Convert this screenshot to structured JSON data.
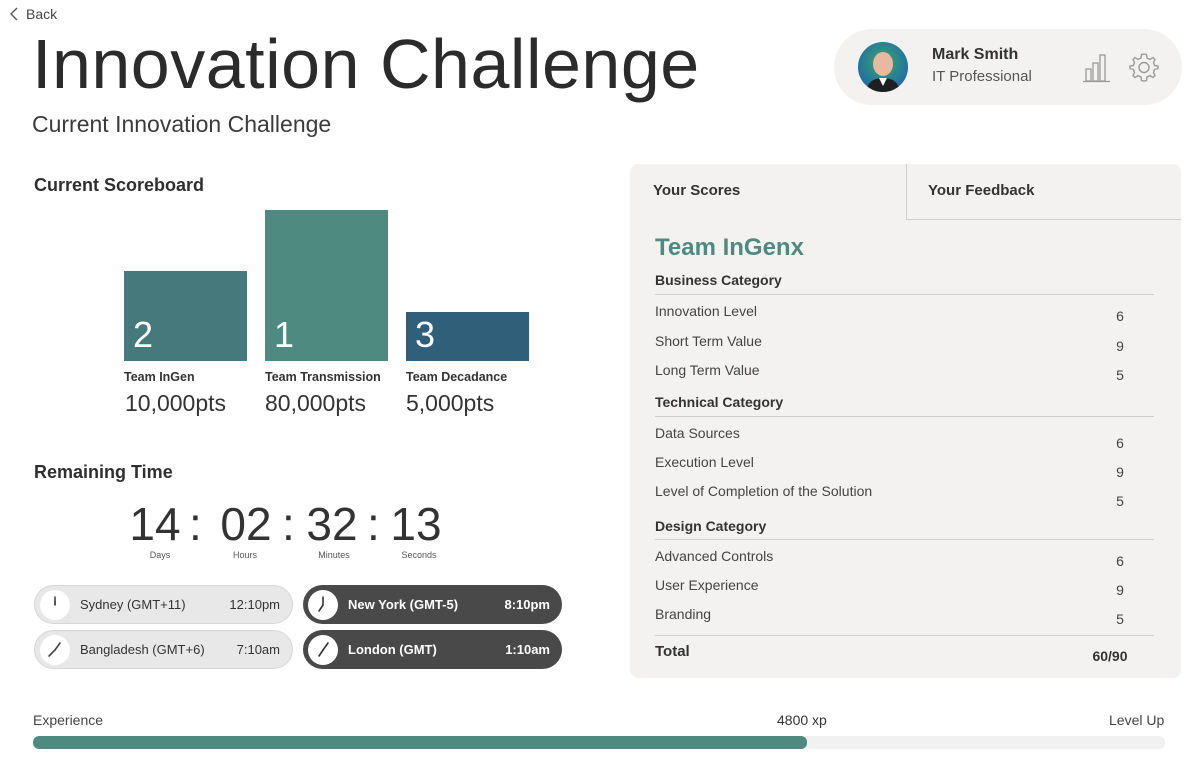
{
  "nav": {
    "back_label": "Back"
  },
  "header": {
    "title": "Innovation Challenge",
    "subtitle": "Current Innovation Challenge"
  },
  "profile": {
    "name": "Mark Smith",
    "role": "IT Professional",
    "icons": [
      "bar-chart-icon",
      "gear-icon"
    ]
  },
  "scoreboard": {
    "title": "Current Scoreboard",
    "teams": [
      {
        "rank": "2",
        "name": "Team InGen",
        "points": "10,000pts",
        "color": "#46797c"
      },
      {
        "rank": "1",
        "name": "Team Transmission",
        "points": "80,000pts",
        "color": "#4f8a80"
      },
      {
        "rank": "3",
        "name": "Team Decadance",
        "points": "5,000pts",
        "color": "#2f5f79"
      }
    ]
  },
  "countdown": {
    "title": "Remaining Time",
    "separator": ":",
    "units": [
      {
        "value": "14",
        "label": "Days"
      },
      {
        "value": "02",
        "label": "Hours"
      },
      {
        "value": "32",
        "label": "Minutes"
      },
      {
        "value": "13",
        "label": "Seconds"
      }
    ]
  },
  "timezones": [
    {
      "city": "Sydney (GMT+11)",
      "time": "12:10pm",
      "theme": "light"
    },
    {
      "city": "New York (GMT-5)",
      "time": "8:10pm",
      "theme": "dark"
    },
    {
      "city": "Bangladesh (GMT+6)",
      "time": "7:10am",
      "theme": "light"
    },
    {
      "city": "London (GMT)",
      "time": "1:10am",
      "theme": "dark"
    }
  ],
  "scores": {
    "tabs": [
      "Your Scores",
      "Your Feedback"
    ],
    "team": "Team InGenx",
    "categories": [
      {
        "name": "Business Category",
        "items": [
          {
            "label": "Innovation Level",
            "value": "6"
          },
          {
            "label": "Short Term Value",
            "value": "9"
          },
          {
            "label": "Long Term Value",
            "value": "5"
          }
        ]
      },
      {
        "name": "Technical Category",
        "items": [
          {
            "label": "Data Sources",
            "value": "6"
          },
          {
            "label": "Execution Level",
            "value": "9"
          },
          {
            "label": "Level of Completion of the Solution",
            "value": "5"
          }
        ]
      },
      {
        "name": "Design Category",
        "items": [
          {
            "label": "Advanced Controls",
            "value": "6"
          },
          {
            "label": "User Experience",
            "value": "9"
          },
          {
            "label": "Branding",
            "value": "5"
          }
        ]
      }
    ],
    "total_label": "Total",
    "total_value": "60/90"
  },
  "experience": {
    "label": "Experience",
    "value": "4800 xp",
    "level_label": "Level Up",
    "progress": 0.684,
    "color": "#4f8a80"
  }
}
